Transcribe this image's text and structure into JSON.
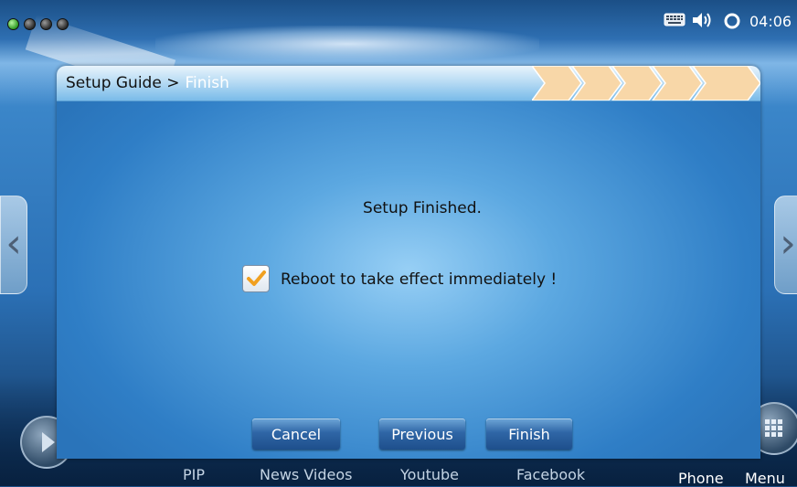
{
  "status_bar": {
    "indicator_dots": [
      "green",
      "gray",
      "gray",
      "gray"
    ],
    "icons": [
      "keyboard-icon",
      "speaker-icon",
      "sync-icon"
    ],
    "time": "04:06"
  },
  "dialog": {
    "breadcrumb_root": "Setup Guide >",
    "breadcrumb_current": "Finish",
    "step_count": 5,
    "message": "Setup Finished.",
    "checkbox": {
      "checked": true,
      "label": "Reboot to take effect immediately !"
    },
    "buttons": {
      "cancel": "Cancel",
      "previous": "Previous",
      "finish": "Finish"
    }
  },
  "dock": {
    "labels": {
      "pip": "PIP",
      "news_videos": "News Videos",
      "youtube": "Youtube",
      "facebook": "Facebook",
      "phone": "Phone",
      "menu": "Menu"
    }
  },
  "colors": {
    "accent_orange": "#f0a020",
    "header_blue": "#b9dcf4",
    "button_blue": "#2f66a6"
  }
}
